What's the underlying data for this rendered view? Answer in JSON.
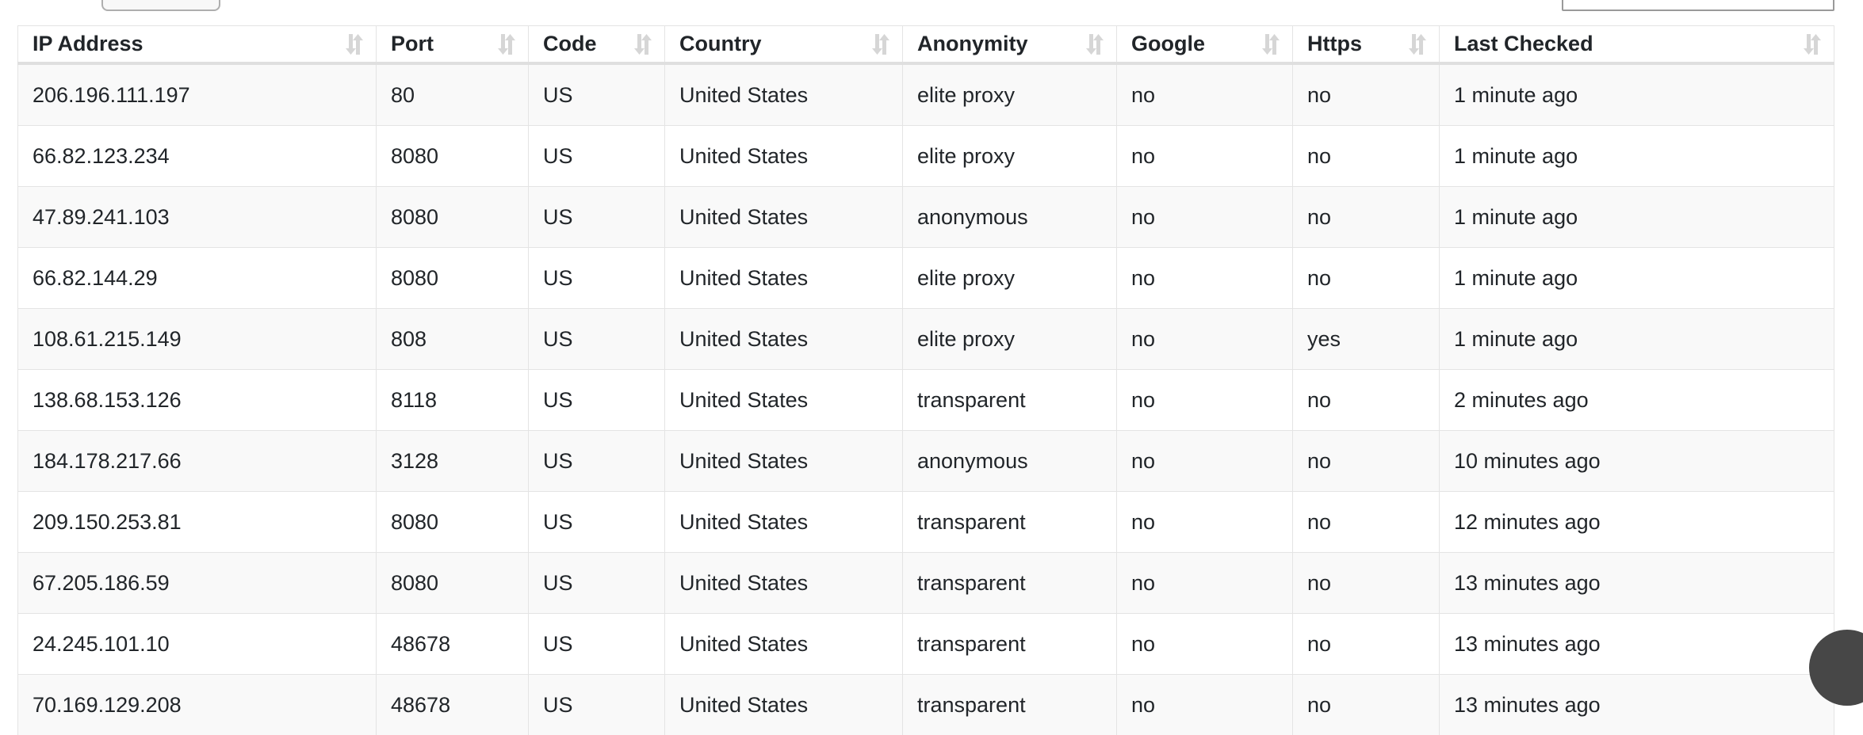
{
  "controls": {
    "length_select_value": "",
    "search_value": "",
    "search_placeholder": ""
  },
  "table": {
    "columns": [
      {
        "key": "ip",
        "label": "IP Address",
        "sort_icon": "sort-updown-icon"
      },
      {
        "key": "port",
        "label": "Port",
        "sort_icon": "sort-updown-icon"
      },
      {
        "key": "code",
        "label": "Code",
        "sort_icon": "sort-updown-icon"
      },
      {
        "key": "country",
        "label": "Country",
        "sort_icon": "sort-updown-icon"
      },
      {
        "key": "anonymity",
        "label": "Anonymity",
        "sort_icon": "sort-updown-icon"
      },
      {
        "key": "google",
        "label": "Google",
        "sort_icon": "sort-updown-icon"
      },
      {
        "key": "https",
        "label": "Https",
        "sort_icon": "sort-updown-icon"
      },
      {
        "key": "last",
        "label": "Last Checked",
        "sort_icon": "sort-updown-icon"
      }
    ],
    "rows": [
      {
        "ip": "206.196.111.197",
        "port": "80",
        "code": "US",
        "country": "United States",
        "anonymity": "elite proxy",
        "google": "no",
        "https": "no",
        "last": "1 minute ago"
      },
      {
        "ip": "66.82.123.234",
        "port": "8080",
        "code": "US",
        "country": "United States",
        "anonymity": "elite proxy",
        "google": "no",
        "https": "no",
        "last": "1 minute ago"
      },
      {
        "ip": "47.89.241.103",
        "port": "8080",
        "code": "US",
        "country": "United States",
        "anonymity": "anonymous",
        "google": "no",
        "https": "no",
        "last": "1 minute ago"
      },
      {
        "ip": "66.82.144.29",
        "port": "8080",
        "code": "US",
        "country": "United States",
        "anonymity": "elite proxy",
        "google": "no",
        "https": "no",
        "last": "1 minute ago"
      },
      {
        "ip": "108.61.215.149",
        "port": "808",
        "code": "US",
        "country": "United States",
        "anonymity": "elite proxy",
        "google": "no",
        "https": "yes",
        "last": "1 minute ago"
      },
      {
        "ip": "138.68.153.126",
        "port": "8118",
        "code": "US",
        "country": "United States",
        "anonymity": "transparent",
        "google": "no",
        "https": "no",
        "last": "2 minutes ago"
      },
      {
        "ip": "184.178.217.66",
        "port": "3128",
        "code": "US",
        "country": "United States",
        "anonymity": "anonymous",
        "google": "no",
        "https": "no",
        "last": "10 minutes ago"
      },
      {
        "ip": "209.150.253.81",
        "port": "8080",
        "code": "US",
        "country": "United States",
        "anonymity": "transparent",
        "google": "no",
        "https": "no",
        "last": "12 minutes ago"
      },
      {
        "ip": "67.205.186.59",
        "port": "8080",
        "code": "US",
        "country": "United States",
        "anonymity": "transparent",
        "google": "no",
        "https": "no",
        "last": "13 minutes ago"
      },
      {
        "ip": "24.245.101.10",
        "port": "48678",
        "code": "US",
        "country": "United States",
        "anonymity": "transparent",
        "google": "no",
        "https": "no",
        "last": "13 minutes ago"
      },
      {
        "ip": "70.169.129.208",
        "port": "48678",
        "code": "US",
        "country": "United States",
        "anonymity": "transparent",
        "google": "no",
        "https": "no",
        "last": "13 minutes ago"
      }
    ]
  },
  "colors": {
    "row_stripe": "#f9f9f9",
    "row_plain": "#ffffff",
    "border": "#e4e4e4",
    "header_rule": "#dfdfdf",
    "sort_icon": "#d6d6d6",
    "text": "#212529",
    "bubble": "#474747"
  }
}
